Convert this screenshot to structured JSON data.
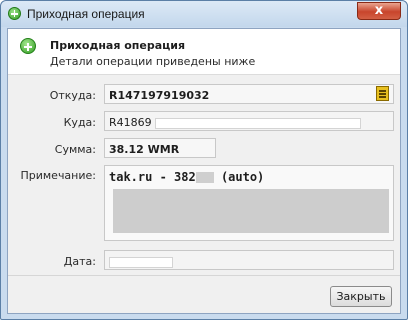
{
  "window": {
    "title": "Приходная операция",
    "close_glyph": "x"
  },
  "header": {
    "title": "Приходная операция",
    "subtitle": "Детали операции приведены ниже",
    "icon": "add-circle-icon"
  },
  "form": {
    "from_label": "Откуда:",
    "from_value": "R147197919032",
    "to_label": "Куда:",
    "to_value": "R41869",
    "sum_label": "Сумма:",
    "sum_value": "38.12 WMR",
    "note_label": "Примечание:",
    "note_prefix": "tak.ru - 382",
    "note_suffix": "(auto)",
    "date_label": "Дата:"
  },
  "footer": {
    "close_label": "Закрыть"
  }
}
